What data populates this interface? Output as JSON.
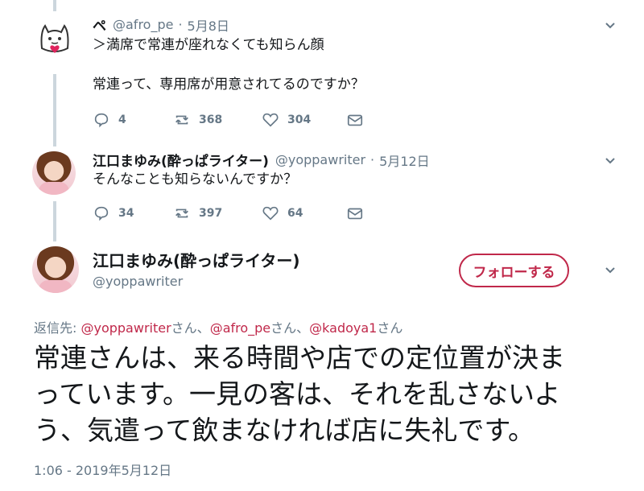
{
  "tweet1": {
    "name": "ペ",
    "handle": "@afro_pe",
    "date": "5月8日",
    "line1": "＞満席で常連が座れなくても知らん顔",
    "line2": "常連って、専用席が用意されてるのですか？",
    "replies": "4",
    "retweets": "368",
    "likes": "304"
  },
  "tweet2": {
    "name": "江口まゆみ(酔っぱライター)",
    "handle": "@yoppawriter",
    "date": "5月12日",
    "text": "そんなことも知らないんですか？",
    "replies": "34",
    "retweets": "397",
    "likes": "64"
  },
  "main": {
    "name": "江口まゆみ(酔っぱライター)",
    "handle": "@yoppawriter",
    "follow_label": "フォローする",
    "reply_prefix": "返信先: ",
    "mention1": "@yoppawriter",
    "suffix1": "さん、",
    "mention2": "@afro_pe",
    "suffix2": "さん、",
    "mention3": "@kadoya1",
    "suffix3": "さん",
    "text_line1": "常連さんは、来る時間や店での定位置が決ま",
    "text_line2": "っています。一見の客は、それを乱さないよ",
    "text_line3": "う、気遣って飲まなければ店に失礼です。",
    "timestamp": "1:06 - 2019年5月12日"
  },
  "colors": {
    "accent": "#c0284a",
    "secondary_text": "#657786",
    "thread_line": "#ccd6dd"
  }
}
